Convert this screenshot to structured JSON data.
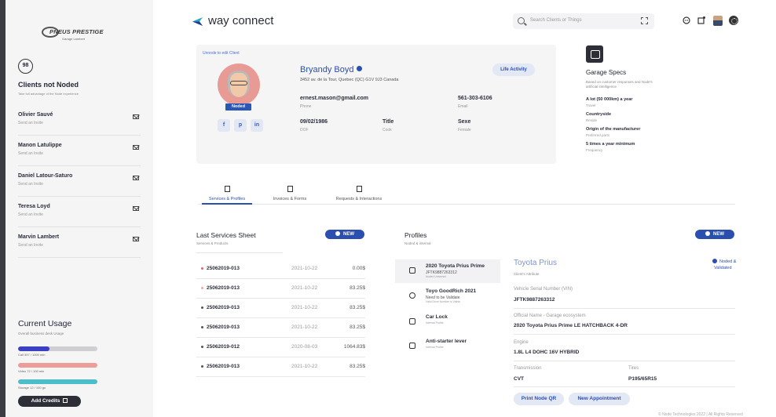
{
  "sidebar": {
    "logo": {
      "brand": "PNEUS PRESTIGE",
      "tagline": "Garage Lambert"
    },
    "noded_count": "98",
    "title": "Clients not Noded",
    "subtitle": "Take full advantage of the Node experience",
    "clients": [
      {
        "name": "Olivier Sauvé",
        "status": "Send an Invite"
      },
      {
        "name": "Manon Latulippe",
        "status": "Send an Invite"
      },
      {
        "name": "Daniel Latour-Saturo",
        "status": "Send an Invite"
      },
      {
        "name": "Teresa Loyd",
        "status": "Send an Invite"
      },
      {
        "name": "Marvin Lambert",
        "status": "Send an Invite"
      }
    ],
    "usage": {
      "title": "Current Usage",
      "subtitle": "Overall business desk Usage",
      "bars": [
        {
          "label": "Call 397 / 1000 min",
          "fraction": 0.4,
          "color": "#3a3fc4"
        },
        {
          "label": "Video 72 / 100 min",
          "fraction": 1.0,
          "color": "#ec9d9a"
        },
        {
          "label": "Storage 12 / 100 go",
          "fraction": 1.0,
          "color": "#4dbdca"
        }
      ]
    },
    "add_credits": "Add Credits"
  },
  "header": {
    "app_name": "way connect",
    "search_placeholder": "Search Clients or Things",
    "accent": "#2b4fae"
  },
  "profile": {
    "unnode_link": "Unnode to edit Client",
    "name": "Bryandy Boyd",
    "address": "3452 av. de la Tour, Quebec (QC) G1V 9J3 Canada",
    "noded_tag": "Noded",
    "life_activity": "Life Activity",
    "socials": [
      "f",
      "p",
      "in"
    ],
    "fields": [
      {
        "value": "ernest.mason@gmail.com",
        "label": "Phone"
      },
      {
        "value": "561-303-6106",
        "label": "Email"
      },
      {
        "value": "09/02/1986",
        "label": "DOF"
      },
      {
        "value": "Title",
        "label": "Cook"
      },
      {
        "value": "Sexe",
        "label": "Female"
      }
    ]
  },
  "garage_specs": {
    "title": "Garage Specs",
    "description": "Based on customer responses and Node's artificial intelligence",
    "items": [
      {
        "value": "A lot (50 000km) a year",
        "label": "Travel"
      },
      {
        "value": "Countryside",
        "label": "Reside"
      },
      {
        "value": "Origin of the manufacturer",
        "label": "Preferred parts"
      },
      {
        "value": "5 times a year minimum",
        "label": "Frequency"
      }
    ]
  },
  "tabs": [
    {
      "label": "Services & Profiles",
      "icon": "document-icon"
    },
    {
      "label": "Invoices & Forms",
      "icon": "list-icon"
    },
    {
      "label": "Requests & Interactions",
      "icon": "bell-icon"
    }
  ],
  "services": {
    "title": "Last Services Sheet",
    "subtitle": "Services & Products",
    "new_label": "NEW",
    "rows": [
      {
        "id": "25062019-013",
        "date": "2021-10-22",
        "amount": "0.00$",
        "dot": "#e0666e"
      },
      {
        "id": "25062019-013",
        "date": "2021-10-22",
        "amount": "83.25$",
        "dot": "#f2a7a7"
      },
      {
        "id": "25062019-013",
        "date": "2021-10-22",
        "amount": "83.25$",
        "dot": "#555555"
      },
      {
        "id": "25062019-013",
        "date": "2021-10-22",
        "amount": "83.25$",
        "dot": "#555555"
      },
      {
        "id": "25062019-012",
        "date": "2020-08-03",
        "amount": "1064.83$",
        "dot": "#555555"
      },
      {
        "id": "25062019-013",
        "date": "2021-10-22",
        "amount": "83.25$",
        "dot": "#555555"
      }
    ]
  },
  "profiles": {
    "title": "Profiles",
    "subtitle": "Noded & internal",
    "new_label": "NEW",
    "items": [
      {
        "name": "2020 Toyota Prius Prime",
        "sub": "JFTK9887263312",
        "tag": "Noded Universel"
      },
      {
        "name": "Toyo GoodRich 2021",
        "sub": "Need to be Validate",
        "tag": "Valid Drive Number is Valide"
      },
      {
        "name": "Car Lock",
        "sub": "",
        "tag": "Internal Profile"
      },
      {
        "name": "Anti-starter lever",
        "sub": "",
        "tag": "Internal Profile"
      }
    ]
  },
  "detail": {
    "title": "Toyota Prius",
    "subtitle": "Client's Attribute",
    "status": [
      "Noded &",
      "Validated"
    ],
    "fields": [
      {
        "label": "Vehicle Serial Number (VIN)",
        "value": "JFTK9887263312"
      },
      {
        "label": "Official Name - Garage ecosystem",
        "value": "2020 Toyota Prius Prime LE HATCHBACK 4-DR"
      },
      {
        "label": "Engine",
        "value": "1.8L L4 DOHC 16V HYBRID"
      },
      {
        "label": "Transmission",
        "value": "CVT"
      },
      {
        "label": "Tires",
        "value": "P195/65R15"
      }
    ],
    "print_qr": "Print Node QR",
    "new_appointment": "New Appointment"
  },
  "footer": "© Node Technologies 2022 | All Rights Reserved"
}
